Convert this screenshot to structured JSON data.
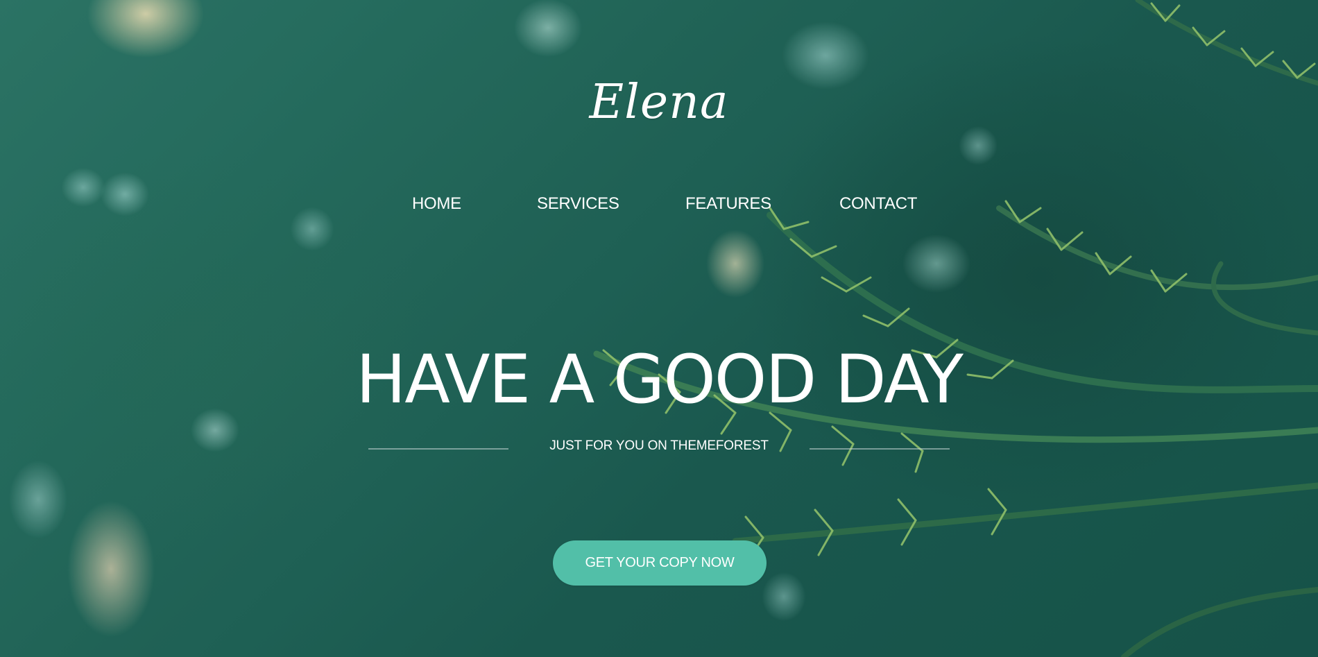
{
  "brand": {
    "logo_text": "Elena"
  },
  "nav": {
    "items": [
      {
        "label": "HOME"
      },
      {
        "label": "SERVICES"
      },
      {
        "label": "FEATURES"
      },
      {
        "label": "CONTACT"
      }
    ]
  },
  "hero": {
    "headline": "HAVE A GOOD DAY",
    "tagline": "JUST FOR YOU ON THEMEFOREST",
    "cta_label": "GET YOUR COPY NOW"
  },
  "colors": {
    "accent": "#52bfa8",
    "text": "#ffffff",
    "background": "#246a5c"
  }
}
